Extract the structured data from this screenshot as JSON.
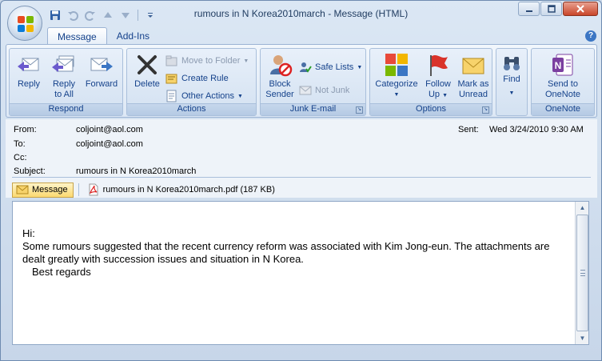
{
  "window": {
    "title": "rumours in N Korea2010march  -  Message (HTML)"
  },
  "quick_access": {
    "icons": [
      "save-icon",
      "undo-icon",
      "redo-icon",
      "previous-item-icon",
      "next-item-icon",
      "customize-dropdown-icon"
    ]
  },
  "tabs": [
    {
      "label": "Message",
      "active": true
    },
    {
      "label": "Add-Ins",
      "active": false
    }
  ],
  "ribbon": {
    "respond": {
      "label": "Respond",
      "reply": "Reply",
      "reply_all_1": "Reply",
      "reply_all_2": "to All",
      "forward": "Forward"
    },
    "actions": {
      "label": "Actions",
      "delete": "Delete",
      "move_to_folder": "Move to Folder",
      "create_rule": "Create Rule",
      "other_actions": "Other Actions"
    },
    "junk": {
      "label": "Junk E-mail",
      "block_sender_1": "Block",
      "block_sender_2": "Sender",
      "safe_lists": "Safe Lists",
      "not_junk": "Not Junk"
    },
    "options": {
      "label": "Options",
      "categorize": "Categorize",
      "follow_up_1": "Follow",
      "follow_up_2": "Up",
      "mark_unread_1": "Mark as",
      "mark_unread_2": "Unread"
    },
    "find": {
      "label": "Find"
    },
    "onenote": {
      "label": "OneNote",
      "send_1": "Send to",
      "send_2": "OneNote"
    }
  },
  "header": {
    "from_label": "From:",
    "from_value": "coljoint@aol.com",
    "to_label": "To:",
    "to_value": "coljoint@aol.com",
    "cc_label": "Cc:",
    "cc_value": "",
    "subject_label": "Subject:",
    "subject_value": "rumours in N Korea2010march",
    "sent_label": "Sent:",
    "sent_value": "Wed 3/24/2010 9:30 AM"
  },
  "attachments": {
    "message_label": "Message",
    "file_label": "rumours in N Korea2010march.pdf (187 KB)"
  },
  "body": {
    "line1": "Hi:",
    "line2": "Some rumours suggested that the recent currency reform was associated with Kim Jong-eun.  The attachments are dealt greatly with succession issues and situation in N Korea.",
    "line3": "Best regards"
  },
  "colors": {
    "accent": "#15428b",
    "ribbon_bg": "#dde8f5",
    "close_button": "#c9462a"
  }
}
